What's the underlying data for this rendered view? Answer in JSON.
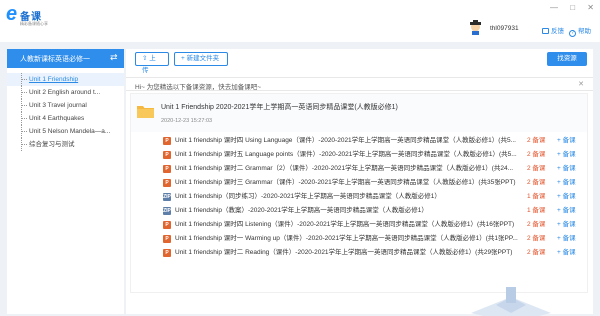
{
  "app": {
    "brand_name": "备课",
    "brand_tagline": "精彩备课随心享"
  },
  "header": {
    "username": "thl097931",
    "feedback_label": "反馈",
    "help_label": "帮助",
    "window_controls": [
      "—",
      "□",
      "✕"
    ]
  },
  "sidebar": {
    "subject_label": "人教新课标英语必修一",
    "switch_icon": "⇄",
    "items": [
      {
        "label": "Unit 1 Friendship",
        "selected": true
      },
      {
        "label": "Unit 2 English around t...",
        "selected": false
      },
      {
        "label": "Unit 3 Travel journal",
        "selected": false
      },
      {
        "label": "Unit 4 Earthquakes",
        "selected": false
      },
      {
        "label": "Unit 5 Nelson Mandela—a...",
        "selected": false
      },
      {
        "label": "综合复习与测试",
        "selected": false
      }
    ]
  },
  "toolbar": {
    "upload_label": "上传",
    "new_folder_label": "新建文件夹",
    "find_label": "找资源"
  },
  "hint": {
    "text": "Hi~ 为您精选以下备课资源，快去加备课吧~",
    "close": "✕"
  },
  "package": {
    "title": "Unit 1 Friendship 2020-2021学年上学期高一英语同步精品课堂(人教版必修1)",
    "date": "2020-12-23 15:27:03"
  },
  "files": [
    {
      "type": "ppt",
      "type_label": "P",
      "title": "Unit 1 friendship 课时四 Using Language（课件）-2020-2021学年上学期高一英语同步精品课堂（人教版必修1）(共5...",
      "downloads": "2 备课",
      "action": "+ 备课"
    },
    {
      "type": "ppt",
      "type_label": "P",
      "title": "Unit 1 friendship 课时五 Language points（课件）-2020-2021学年上学期高一英语同步精品课堂（人教版必修1）(共5...",
      "downloads": "2 备课",
      "action": "+ 备课"
    },
    {
      "type": "ppt",
      "type_label": "P",
      "title": "Unit 1 friendship 课时二 Grammar（2）（课件）-2020-2021学年上学期高一英语同步精品课堂（人教版必修1）(共24...",
      "downloads": "2 备课",
      "action": "+ 备课"
    },
    {
      "type": "ppt",
      "type_label": "P",
      "title": "Unit 1 friendship 课时三 Grammar（课件）-2020-2021学年上学期高一英语同步精品课堂（人教版必修1）(共35张PPT)",
      "downloads": "2 备课",
      "action": "+ 备课"
    },
    {
      "type": "zip",
      "type_label": "ZIP",
      "title": "Unit 1 friendship（同步练习）-2020-2021学年上学期高一英语同步精品课堂（人教版必修1）",
      "downloads": "1 备课",
      "action": "+ 备课"
    },
    {
      "type": "zip",
      "type_label": "ZIP",
      "title": "Unit 1 friendship（教案）-2020-2021学年上学期高一英语同步精品课堂（人教版必修1）",
      "downloads": "1 备课",
      "action": "+ 备课"
    },
    {
      "type": "ppt",
      "type_label": "P",
      "title": "Unit 1 friendship 课时四 Listening（课件）-2020-2021学年上学期高一英语同步精品课堂（人教版必修1）(共16张PPT)",
      "downloads": "2 备课",
      "action": "+ 备课"
    },
    {
      "type": "ppt",
      "type_label": "P",
      "title": "Unit 1 friendship 课时一 Warming up（课件）-2020-2021学年上学期高一英语同步精品课堂（人教版必修1）(共1张PP...",
      "downloads": "2 备课",
      "action": "+ 备课"
    },
    {
      "type": "ppt",
      "type_label": "P",
      "title": "Unit 1 friendship 课时二 Reading（课件）-2020-2021学年上学期高一英语同步精品课堂（人教版必修1）(共29张PPT)",
      "downloads": "2 备课",
      "action": "+ 备课"
    }
  ]
}
